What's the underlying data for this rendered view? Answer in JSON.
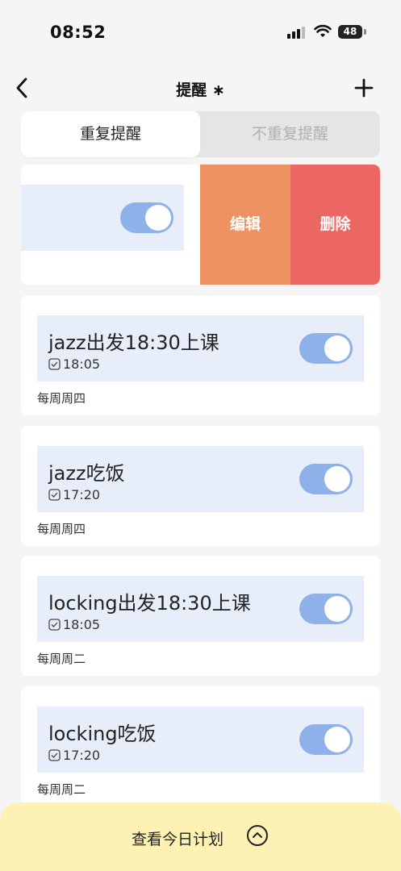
{
  "status_bar": {
    "time": "08:52",
    "battery": "48"
  },
  "header": {
    "title": "提醒 ∗"
  },
  "tabs": [
    {
      "label": "重复提醒",
      "active": true
    },
    {
      "label": "不重复提醒",
      "active": false
    }
  ],
  "swipe_actions": {
    "edit_label": "编辑",
    "delete_label": "删除"
  },
  "reminders": [
    {
      "title": "jazz出发18:30上课",
      "time": "18:05",
      "repeat": "每周周四",
      "enabled": true
    },
    {
      "title": "jazz吃饭",
      "time": "17:20",
      "repeat": "每周周四",
      "enabled": true
    },
    {
      "title": "locking出发18:30上课",
      "time": "18:05",
      "repeat": "每周周二",
      "enabled": true
    },
    {
      "title": "locking吃饭",
      "time": "17:20",
      "repeat": "每周周二",
      "enabled": true
    }
  ],
  "bottom_bar": {
    "label": "查看今日计划"
  },
  "colors": {
    "toggle_on": "#8fb1ea",
    "edit_action": "#ee9163",
    "delete_action": "#ec6663",
    "bottom_bar": "#fdf2b4",
    "card_inner": "#e8eef9"
  }
}
